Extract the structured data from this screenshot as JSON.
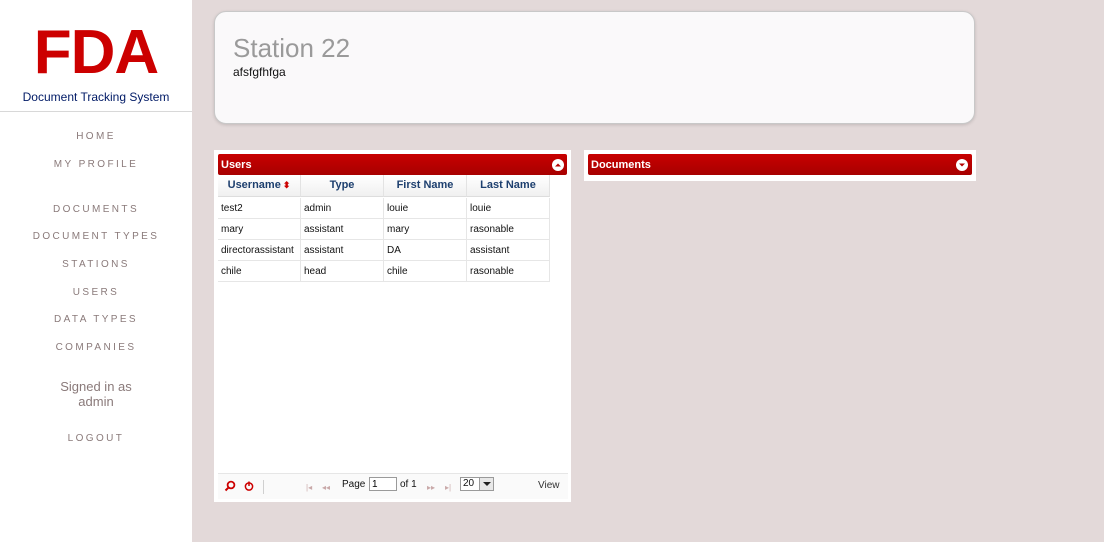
{
  "brand": {
    "logo": "FDA",
    "subtitle": "Document Tracking System"
  },
  "nav": [
    {
      "label": "HOME"
    },
    {
      "label": "MY PROFILE"
    },
    {
      "label": "DOCUMENTS"
    },
    {
      "label": "DOCUMENT TYPES"
    },
    {
      "label": "STATIONS"
    },
    {
      "label": "USERS"
    },
    {
      "label": "DATA TYPES"
    },
    {
      "label": "COMPANIES"
    }
  ],
  "signed_in": {
    "line1": "Signed in as",
    "line2": "admin"
  },
  "logout": "LOGOUT",
  "station": {
    "title": "Station 22",
    "subtitle": "afsfgfhfga"
  },
  "users_grid": {
    "title": "Users",
    "columns": [
      "Username",
      "Type",
      "First Name",
      "Last Name"
    ],
    "sort_arrow": "⬍",
    "rows": [
      [
        "test2",
        "admin",
        "louie",
        "louie"
      ],
      [
        "mary",
        "assistant",
        "mary",
        "rasonable"
      ],
      [
        "directorassistant",
        "assistant",
        "DA",
        "assistant"
      ],
      [
        "chile",
        "head",
        "chile",
        "rasonable"
      ]
    ],
    "pager": {
      "page_label": "Page",
      "page_value": "1",
      "of_label": "of 1",
      "rows_value": "20",
      "view_label": "View"
    }
  },
  "documents_grid": {
    "title": "Documents"
  },
  "colors": {
    "brand_red": "#cc0000",
    "header_red": "#b50000",
    "bg": "#e3d9d9"
  }
}
